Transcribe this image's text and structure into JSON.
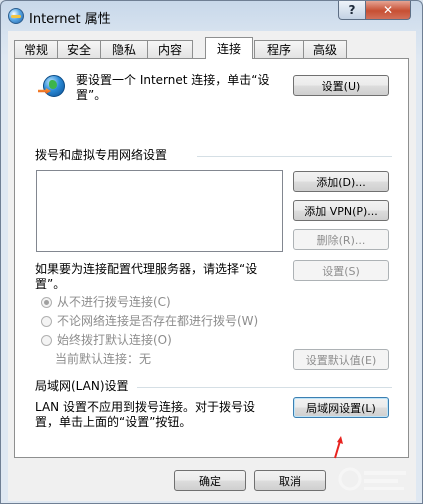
{
  "window": {
    "title": "Internet 属性",
    "help_glyph": "?",
    "close_glyph": "✕"
  },
  "tabs": [
    "常规",
    "安全",
    "隐私",
    "内容",
    "连接",
    "程序",
    "高级"
  ],
  "active_tab": "连接",
  "setup": {
    "text_line1": "要设置一个 Internet 连接，单击“设",
    "text_line2": "置”。",
    "button": "设置(U)"
  },
  "dialup": {
    "section_title": "拨号和虚拟专用网络设置",
    "add_button": "添加(D)...",
    "add_vpn_button": "添加 VPN(P)...",
    "remove_button": "删除(R)...",
    "proxy_text_line1": "如果要为连接配置代理服务器，请选择“设",
    "proxy_text_line2": "置”。",
    "settings_button": "设置(S)",
    "radio_options": [
      "从不进行拨号连接(C)",
      "不论网络连接是否存在都进行拨号(W)",
      "始终拨打默认连接(O)"
    ],
    "selected_option": "从不进行拨号连接(C)",
    "current_default_label": "当前默认连接：无",
    "set_default_button": "设置默认值(E)"
  },
  "lan": {
    "section_title": "局域网(LAN)设置",
    "text_line1": "LAN 设置不应用到拨号连接。对于拨号设",
    "text_line2": "置，单击上面的“设置”按钮。",
    "button": "局域网设置(L)"
  },
  "footer": {
    "ok_button": "确定",
    "cancel_button": "取消"
  },
  "colors": {
    "annotation_arrow": "#e8231f",
    "accent_focus": "#3c7fb1"
  }
}
